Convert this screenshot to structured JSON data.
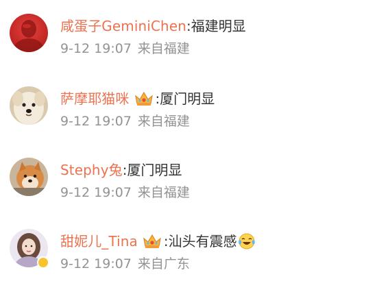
{
  "comments": [
    {
      "username": "咸蛋子GeminiChen",
      "text": ":福建明显",
      "time": "9-12 19:07",
      "source": "来自福建",
      "avatar": "red-portrait-avatar",
      "badge": null,
      "verified": false
    },
    {
      "username": "萨摩耶猫咪",
      "text": ":厦门明显",
      "time": "9-12 19:07",
      "source": "来自福建",
      "avatar": "white-dog-avatar",
      "badge": "crown-icon",
      "verified": false
    },
    {
      "username": "Stephy兔",
      "text": ":厦门明显",
      "time": "9-12 19:07",
      "source": "来自福建",
      "avatar": "shiba-dog-avatar",
      "badge": null,
      "verified": false
    },
    {
      "username": "甜妮儿_Tina",
      "text": ":汕头有震感",
      "time": "9-12 19:07",
      "source": "来自广东",
      "avatar": "girl-portrait-avatar",
      "badge": "crown-icon",
      "verified": true,
      "emoji": "laughing-tears-emoji"
    }
  ],
  "colors": {
    "username": "#eb7350",
    "text": "#333333",
    "meta": "#939393",
    "verified": "#f7c32e"
  }
}
